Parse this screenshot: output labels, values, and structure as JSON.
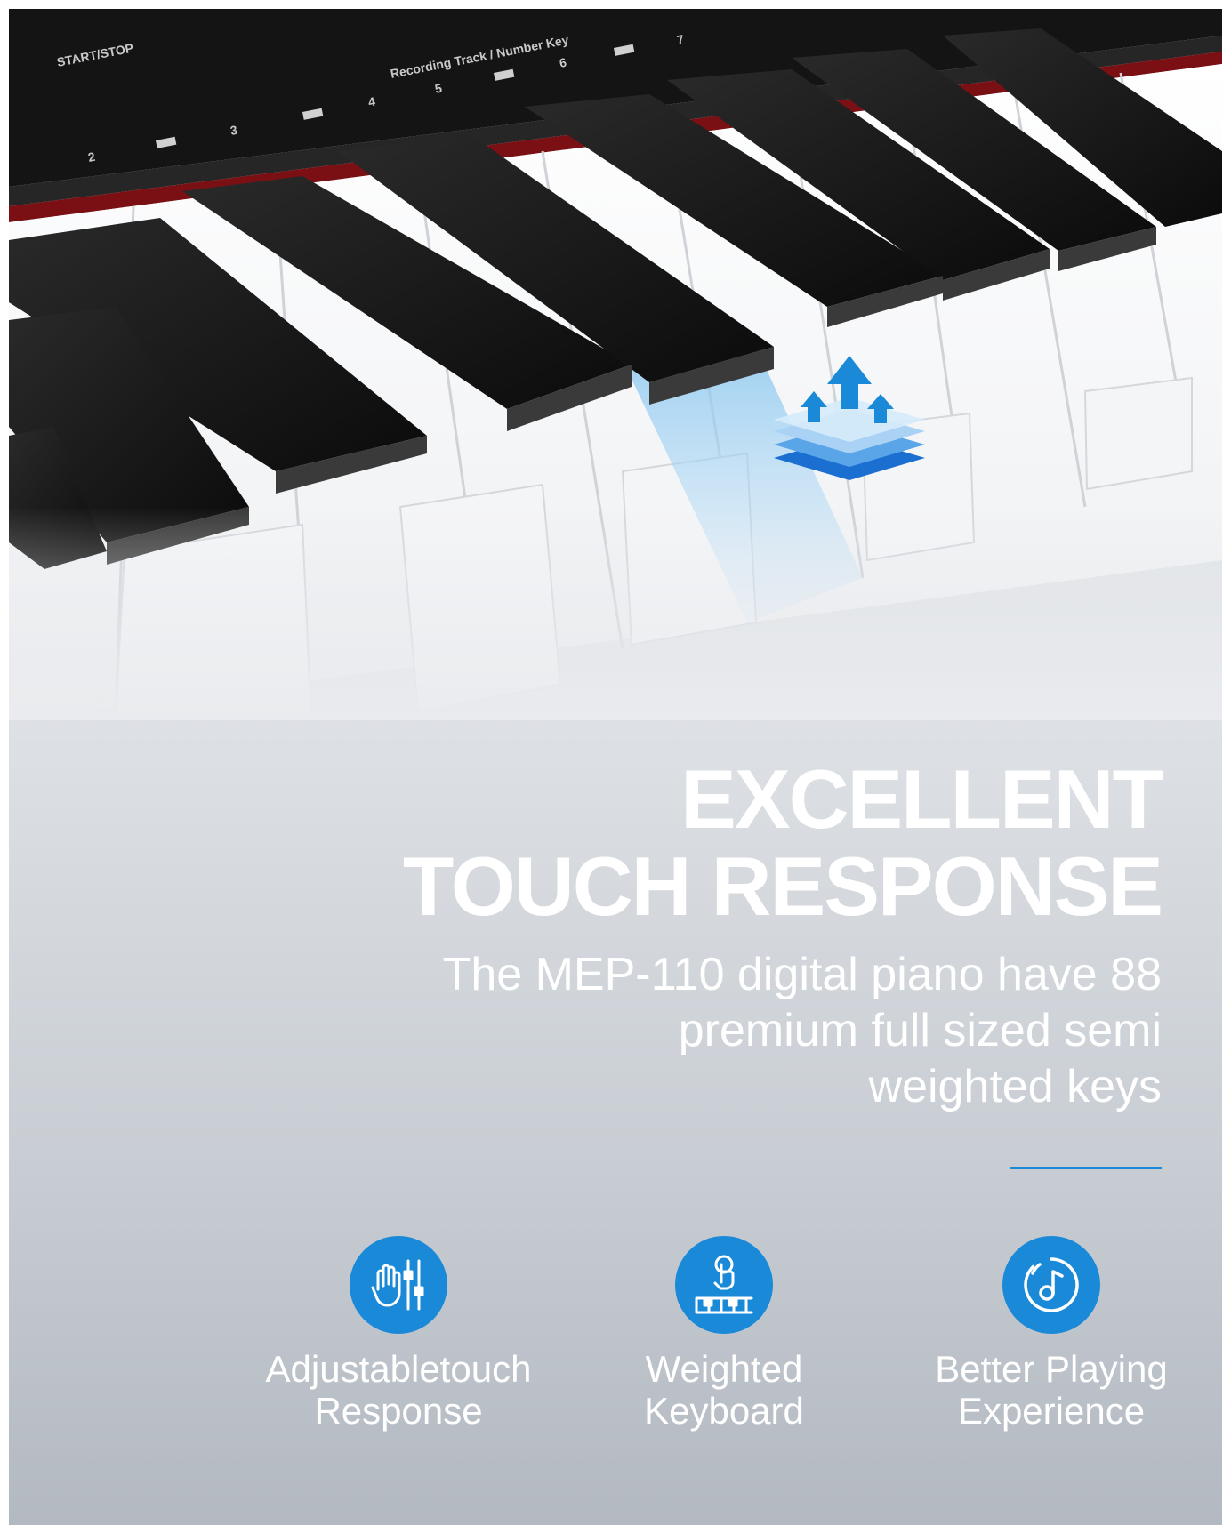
{
  "colors": {
    "accent": "#1a8ad8",
    "text": "#ffffff",
    "background_bottom": "#b3b9c1"
  },
  "panel": {
    "start_stop": "START/STOP",
    "recording_track": "Recording Track / Number Key",
    "numbers": [
      "2",
      "3",
      "4",
      "5",
      "6",
      "7"
    ]
  },
  "headline": {
    "line1": "EXCELLENT",
    "line2": "TOUCH RESPONSE"
  },
  "description": {
    "line1": "The MEP-110 digital piano have 88",
    "line2": "premium full sized semi",
    "line3": "weighted keys"
  },
  "features": [
    {
      "icon": "hand-sliders-icon",
      "line1": "Adjustabletouch",
      "line2": "Response"
    },
    {
      "icon": "finger-press-keys-icon",
      "line1": "Weighted",
      "line2": "Keyboard"
    },
    {
      "icon": "music-note-icon",
      "line1": "Better Playing",
      "line2": "Experience"
    }
  ]
}
